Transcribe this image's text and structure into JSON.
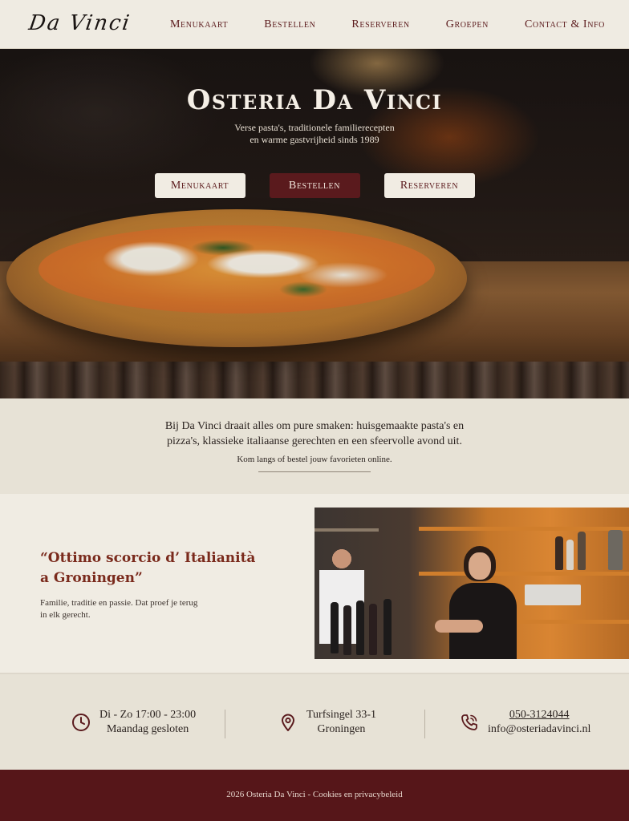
{
  "nav": {
    "logo": "Da Vinci",
    "links": [
      "Menukaart",
      "Bestellen",
      "Reserveren",
      "Groepen",
      "Contact & Info"
    ]
  },
  "hero": {
    "title": "Osteria Da Vinci",
    "subtitle_line1": "Verse pasta's, traditionele familierecepten",
    "subtitle_line2": "en warme gastvrijheid sinds 1989",
    "buttons": [
      "Menukaart",
      "Bestellen",
      "Reserveren"
    ]
  },
  "intro": {
    "line1": "Bij Da Vinci draait alles om pure smaken: huisgemaakte pasta's en",
    "line2": "pizza's, klassieke italiaanse gerechten en een sfeervolle avond uit.",
    "cta": "Kom langs of bestel jouw favorieten online."
  },
  "story": {
    "quote_line1": "“Ottimo scorcio d’ Italianità",
    "quote_line2": "a Groningen”",
    "text_line1": "Familie, traditie en passie. Dat proef je terug",
    "text_line2": "in elk gerecht."
  },
  "info": {
    "hours_line1": "Di - Zo 17:00 - 23:00",
    "hours_line2": "Maandag gesloten",
    "address_line1": "Turfsingel 33-1",
    "address_line2": "Groningen",
    "phone": "050-3124044",
    "email": "info@osteriadavinci.nl"
  },
  "footer": {
    "copyright": "2026 Osteria Da Vinci - ",
    "link": "Cookies en privacybeleid"
  },
  "colors": {
    "accent": "#5a1a1d",
    "quote": "#7a2a1c",
    "background": "#efebe2",
    "band": "#e7e2d6"
  },
  "icons": [
    "clock-icon",
    "map-pin-icon",
    "phone-icon"
  ]
}
